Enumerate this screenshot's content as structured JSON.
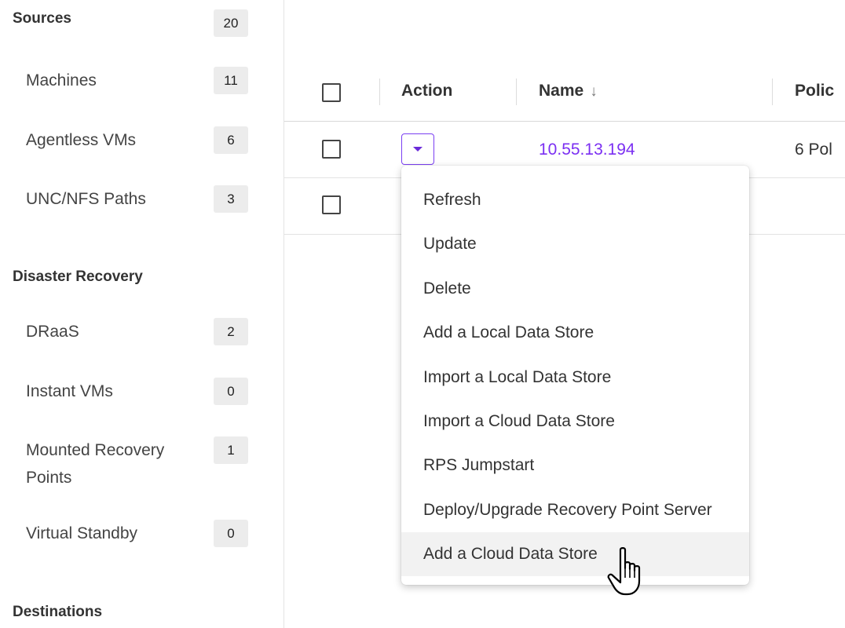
{
  "sidebar": {
    "sources": {
      "title": "Sources",
      "count": "20",
      "items": [
        {
          "label": "Machines",
          "count": "11"
        },
        {
          "label": "Agentless VMs",
          "count": "6"
        },
        {
          "label": "UNC/NFS Paths",
          "count": "3"
        }
      ]
    },
    "disaster_recovery": {
      "title": "Disaster Recovery",
      "items": [
        {
          "label": "DRaaS",
          "count": "2"
        },
        {
          "label": "Instant VMs",
          "count": "0"
        },
        {
          "label": "Mounted Recovery Points",
          "count": "1"
        },
        {
          "label": "Virtual Standby",
          "count": "0"
        }
      ]
    },
    "destinations": {
      "title": "Destinations"
    }
  },
  "table": {
    "headers": {
      "action": "Action",
      "name": "Name",
      "policy": "Polic"
    },
    "name_sort_icon": "arrow-down-icon",
    "rows": [
      {
        "name": "10.55.13.194",
        "policy": "6 Pol"
      },
      {
        "name": "",
        "policy": ""
      }
    ]
  },
  "menu": {
    "items": [
      "Refresh",
      "Update",
      "Delete",
      "Add a Local Data Store",
      "Import a Local Data Store",
      "Import a Cloud Data Store",
      "RPS Jumpstart",
      "Deploy/Upgrade Recovery Point Server",
      "Add a Cloud Data Store"
    ],
    "hovered": "Add a Cloud Data Store"
  },
  "colors": {
    "accent": "#7b2ff2",
    "badge_bg": "#ececec",
    "hover_bg": "#f2f2f2"
  }
}
